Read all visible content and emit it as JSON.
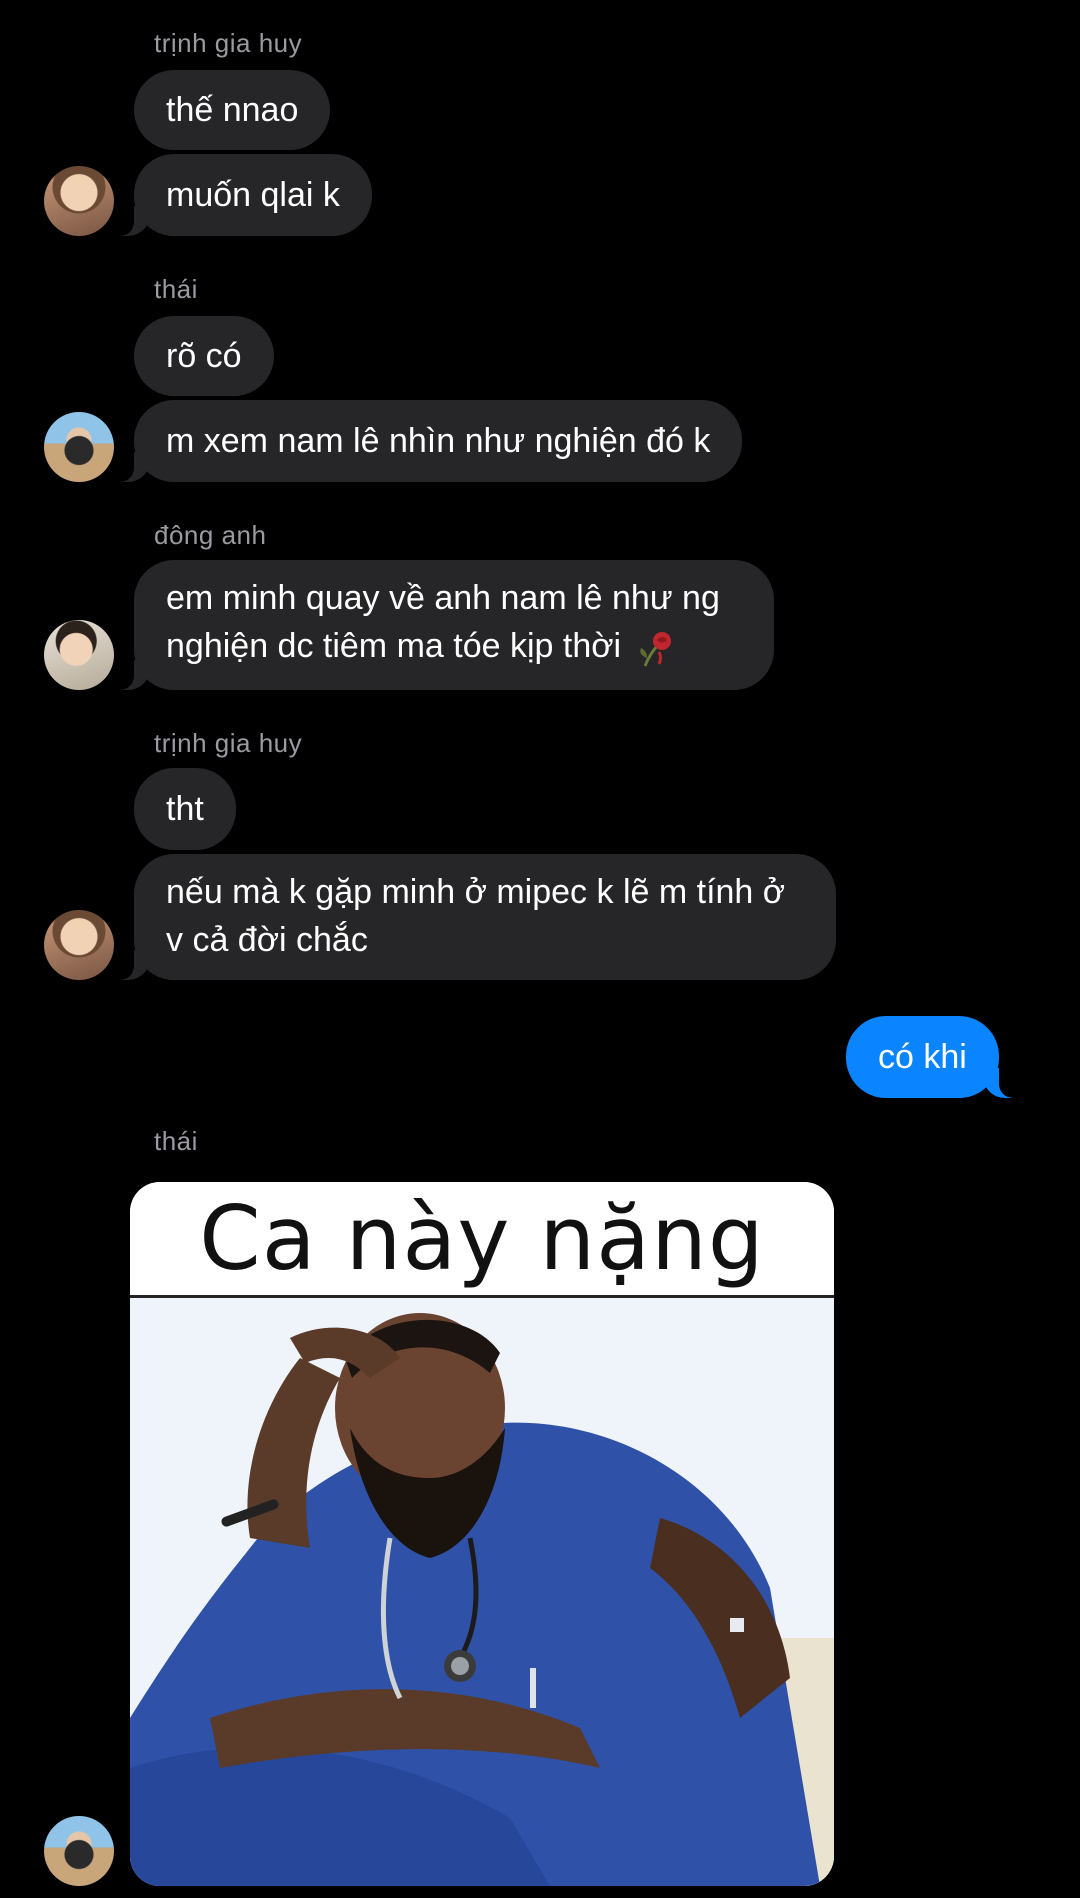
{
  "messages": [
    {
      "sender": "trịnh gia huy",
      "bubbles": [
        "thế nnao",
        "muốn qlai k"
      ]
    },
    {
      "sender": "thái",
      "bubbles": [
        "rõ có",
        "m xem nam lê nhìn như nghiện đó k"
      ]
    },
    {
      "sender": "đông anh",
      "bubbles": [
        "em minh quay về anh nam lê như ng nghiện dc tiêm ma tóe kịp thời"
      ]
    },
    {
      "sender": "trịnh gia huy",
      "bubbles": [
        "tht",
        "nếu mà k gặp minh ở mipec k lẽ m tính ở v cả đời chắc"
      ]
    },
    {
      "sender": "me",
      "bubbles": [
        "có khi"
      ]
    },
    {
      "sender": "thái",
      "image_caption": "Ca này nặng"
    }
  ],
  "icons": {
    "wilted_rose": "wilted-rose-emoji"
  },
  "colors": {
    "background": "#000000",
    "incoming_bubble": "#262629",
    "outgoing_bubble": "#0a84ff",
    "sender_name": "#9a9aa0"
  }
}
